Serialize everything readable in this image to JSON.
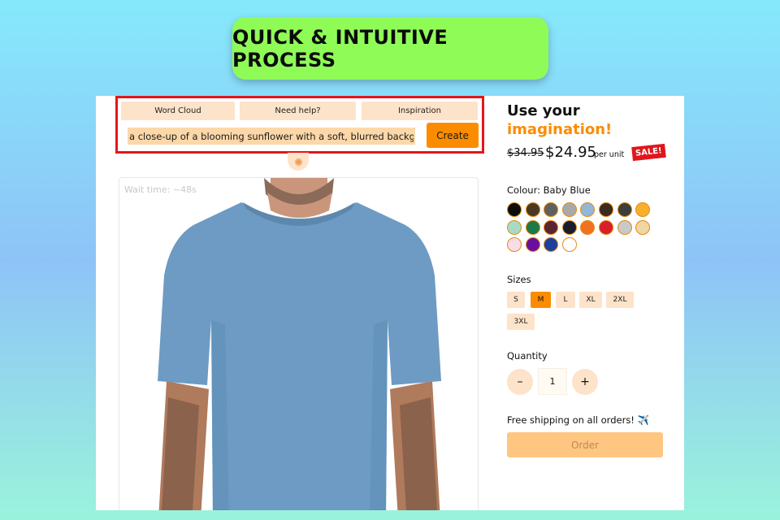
{
  "banner": {
    "title": "QUICK & INTUITIVE PROCESS"
  },
  "generator": {
    "tabs": [
      "Word Cloud",
      "Need help?",
      "Inspiration"
    ],
    "prompt_value": "a close-up of a blooming sunflower with a soft, blurred backgrounc",
    "create_label": "Create",
    "wait_text": "Wait time: ~48s"
  },
  "product": {
    "title_line1": "Use your",
    "title_line2": "imagination!",
    "old_price": "$34.95",
    "new_price": "$24.95",
    "per_unit": "per unit",
    "sale_badge": "SALE!",
    "colour_label": "Colour: Baby Blue",
    "colours": [
      "#0d0d0d",
      "#4a3a24",
      "#5e6160",
      "#a9a9a9",
      "#92b8d6",
      "#3a2a20",
      "#3d3d3d",
      "#f7b02a",
      "#a8dbc6",
      "#1b7a45",
      "#5b2530",
      "#1a1d2c",
      "#f27121",
      "#d91f2b",
      "#c9c9c9",
      "#f0d6a0",
      "#f9dce6",
      "#6a0f9d",
      "#1e3f9a",
      "#ffffff"
    ],
    "sizes_label": "Sizes",
    "sizes": [
      "S",
      "M",
      "L",
      "XL",
      "2XL",
      "3XL"
    ],
    "selected_size": "M",
    "quantity_label": "Quantity",
    "quantity_value": "1",
    "minus": "–",
    "plus": "+",
    "shipping_bold": "Free shipping",
    "shipping_rest": " on all orders! ✈️",
    "order_label": "Order"
  }
}
